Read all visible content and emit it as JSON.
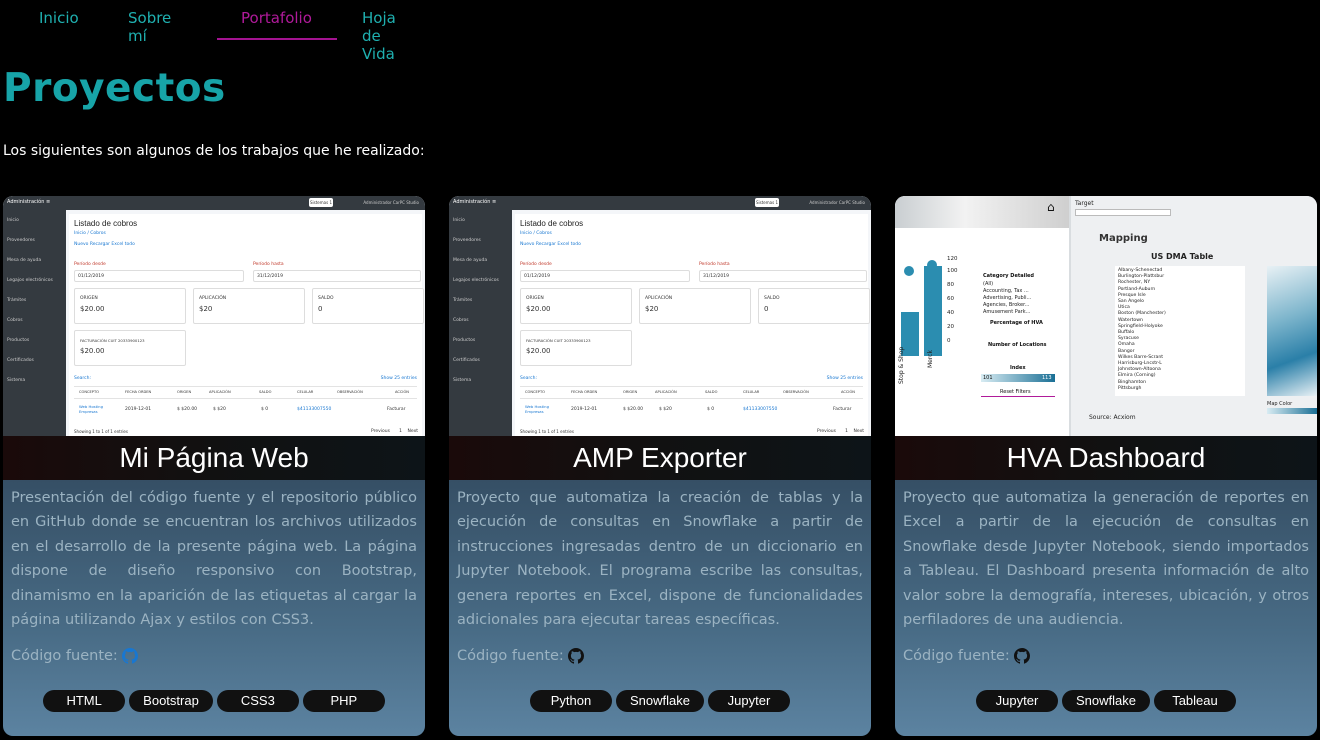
{
  "nav": {
    "items": [
      {
        "label": "Inicio"
      },
      {
        "label": "Sobre mí"
      },
      {
        "label": "Portafolio"
      },
      {
        "label": "Hoja de Vida"
      }
    ]
  },
  "page": {
    "title": "Proyectos",
    "subtitle": "Los siguientes son algunos de los trabajos que he realizado:"
  },
  "cards": [
    {
      "title": "Mi Página Web",
      "description": "Presentación del código fuente y el repositorio público en GitHub donde se encuentran los archivos utilizados en el desarrollo de la presente página web. La página dispone de diseño responsivo con Bootstrap, dinamismo en la aparición de las etiquetas al cargar la página utilizando Ajax y estilos con CSS3.",
      "source_label": "Código fuente:",
      "icon": "github-icon",
      "icon_color": "#1877d1",
      "tags": [
        "HTML",
        "Bootstrap",
        "CSS3",
        "PHP"
      ]
    },
    {
      "title": "AMP Exporter",
      "description": "Proyecto que automatiza la creación de tablas y la ejecución de consultas en Snowflake a partir de instrucciones ingresadas dentro de un diccionario en Jupyter Notebook. El programa escribe las consultas, genera reportes en Excel, dispone de funcionalidades adicionales para ejecutar tareas específicas.",
      "source_label": "Código fuente:",
      "icon": "github-icon",
      "icon_color": "#111111",
      "tags": [
        "Python",
        "Snowflake",
        "Jupyter"
      ]
    },
    {
      "title": "HVA Dashboard",
      "description": "Proyecto que automatiza la generación de reportes en Excel a partir de la ejecución de consultas en Snowflake desde Jupyter Notebook, siendo importados a Tableau. El Dashboard presenta información de alto valor sobre la demografía, intereses, ubicación, y otros perfiladores de una audiencia.",
      "source_label": "Código fuente:",
      "icon": "github-icon",
      "icon_color": "#111111",
      "tags": [
        "Jupyter",
        "Snowflake",
        "Tableau"
      ]
    }
  ],
  "mock_admin": {
    "app": "Administración ≡",
    "system_btn": "Sistemas 1",
    "user": "Administrador CarPC Studio",
    "sidebar": [
      "Inicio",
      "Proveedores",
      "Mesa de ayuda",
      "Legajos electrónicos",
      "Trámites",
      "Cobros",
      "Productos",
      "Certificados",
      "Sistema"
    ],
    "heading": "Listado de cobros",
    "breadcrumb": "Inicio / Cobros",
    "actions": "Nuevo  Recargar  Excel todo",
    "period_from_label": "Período desde",
    "period_from": "01/12/2019",
    "period_to_label": "Período hasta",
    "period_to": "31/12/2019",
    "origen_label": "ORIGEN",
    "origen_value": "$20.00",
    "aplicacion_label": "APLICACIÓN",
    "aplicacion_value": "$20",
    "saldo_label": "SALDO",
    "saldo_value": "0",
    "factura_label": "FACTURACIÓN CUIT 20333900123",
    "factura_value": "$20.00",
    "search_label": "Search:",
    "show_label": "Show 25 entries",
    "columns": [
      "CONCEPTO",
      "FECHA ORDEN",
      "ORIGEN",
      "APLICACIÓN",
      "SALDO",
      "CELULAR",
      "OBSERVACIÓN",
      "ACCIÓN"
    ],
    "row": [
      "Web Hosting Empresas",
      "2019-12-01",
      "$ $20.00",
      "$ $20",
      "$ 0",
      "$41133007550",
      "",
      "Facturar"
    ],
    "footer": "Showing 1 to 1 of 1 entries",
    "pager": [
      "Previous",
      "1",
      "Next"
    ]
  },
  "mock_hva": {
    "target_label": "Target",
    "mapping_title": "Mapping",
    "table_title": "US DMA Table",
    "source": "Source: Acxiom",
    "category_label": "Category Detailed",
    "categories": [
      "(All)",
      "Accounting, Tax ...",
      "Advertising, Publi...",
      "Agencies, Broker...",
      "Amusement Park..."
    ],
    "pct_label": "Percentage of HVA",
    "locations_label": "Number of Locations",
    "index_label": "Index",
    "index_min": "101",
    "index_max": "113",
    "reset": "Reset Filters",
    "bars": [
      "Stop & Shop",
      "Merck"
    ],
    "axis": [
      "120",
      "100",
      "80",
      "60",
      "40",
      "20",
      "0"
    ],
    "dma_rows": [
      "Albany-Schenectad",
      "Burlington-Plattsbur",
      "Rochester, NY",
      "Portland-Auburn",
      "Presque Isle",
      "San Angelo",
      "Utica",
      "Boston (Manchester)",
      "Watertown",
      "Springfield-Holyoke",
      "Buffalo",
      "Syracuse",
      "Omaha",
      "Bangor",
      "Wilkes Barre-Scrant",
      "Harrisburg-Lncstr-L",
      "Johnstown-Altoona",
      "Elmira (Corning)",
      "Binghamton",
      "Pittsburgh"
    ],
    "map_color_label": "Map Color"
  }
}
